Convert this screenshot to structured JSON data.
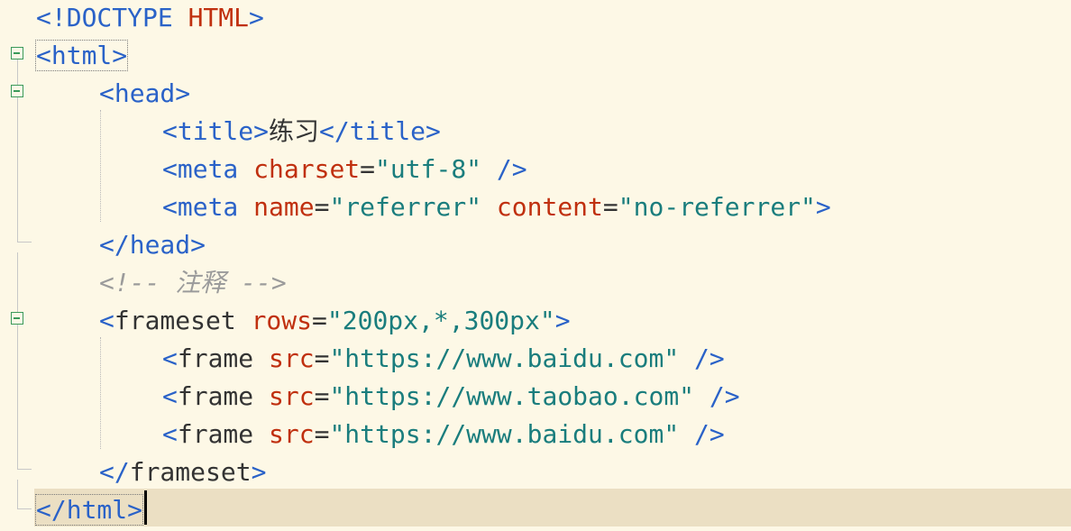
{
  "editor": {
    "lines": [
      {
        "parts": [
          [
            "tag",
            "<!DOCTYPE "
          ],
          [
            "doctype-kw",
            "HTML"
          ],
          [
            "tag",
            ">"
          ]
        ]
      },
      {
        "parts": [
          [
            "tag",
            "<html>"
          ]
        ]
      },
      {
        "parts": [
          [
            "tag",
            "<head>"
          ]
        ]
      },
      {
        "parts": [
          [
            "tag",
            "<title>"
          ],
          [
            "text",
            "练习"
          ],
          [
            "tag",
            "</title>"
          ]
        ]
      },
      {
        "parts": [
          [
            "tag",
            "<meta "
          ],
          [
            "attr",
            "charset"
          ],
          [
            "eq",
            "="
          ],
          [
            "str",
            "\"utf-8\""
          ],
          [
            "tag",
            " />"
          ]
        ]
      },
      {
        "parts": [
          [
            "tag",
            "<meta "
          ],
          [
            "attr",
            "name"
          ],
          [
            "eq",
            "="
          ],
          [
            "str",
            "\"referrer\""
          ],
          [
            "tag",
            " "
          ],
          [
            "attr",
            "content"
          ],
          [
            "eq",
            "="
          ],
          [
            "str",
            "\"no-referrer\""
          ],
          [
            "tag",
            ">"
          ]
        ]
      },
      {
        "parts": [
          [
            "tag",
            "</head>"
          ]
        ]
      },
      {
        "parts": [
          [
            "cmt",
            "<!-- 注释 -->"
          ]
        ]
      },
      {
        "parts": [
          [
            "tag",
            "<"
          ],
          [
            "plain-name",
            "frameset"
          ],
          [
            "tag",
            " "
          ],
          [
            "attr",
            "rows"
          ],
          [
            "eq",
            "="
          ],
          [
            "str",
            "\"200px,*,300px\""
          ],
          [
            "tag",
            ">"
          ]
        ]
      },
      {
        "parts": [
          [
            "tag",
            "<"
          ],
          [
            "plain-name",
            "frame"
          ],
          [
            "tag",
            " "
          ],
          [
            "attr",
            "src"
          ],
          [
            "eq",
            "="
          ],
          [
            "str",
            "\"https://www.baidu.com\""
          ],
          [
            "tag",
            " />"
          ]
        ]
      },
      {
        "parts": [
          [
            "tag",
            "<"
          ],
          [
            "plain-name",
            "frame"
          ],
          [
            "tag",
            " "
          ],
          [
            "attr",
            "src"
          ],
          [
            "eq",
            "="
          ],
          [
            "str",
            "\"https://www.taobao.com\""
          ],
          [
            "tag",
            " />"
          ]
        ]
      },
      {
        "parts": [
          [
            "tag",
            "<"
          ],
          [
            "plain-name",
            "frame"
          ],
          [
            "tag",
            " "
          ],
          [
            "attr",
            "src"
          ],
          [
            "eq",
            "="
          ],
          [
            "str",
            "\"https://www.baidu.com\""
          ],
          [
            "tag",
            " />"
          ]
        ]
      },
      {
        "parts": [
          [
            "tag",
            "</"
          ],
          [
            "plain-name",
            "frameset"
          ],
          [
            "tag",
            ">"
          ]
        ]
      },
      {
        "parts": [
          [
            "tag",
            "</html>"
          ]
        ]
      }
    ]
  },
  "colors": {
    "background": "#fdf8e6",
    "current_line": "#ebdfc3",
    "tag": "#2a62c8",
    "attribute": "#c0300f",
    "string": "#1a7d7d",
    "comment": "#9b9b9b",
    "fold_marker": "#3a9a5a"
  },
  "icons": [
    "fold-collapse-icon"
  ]
}
